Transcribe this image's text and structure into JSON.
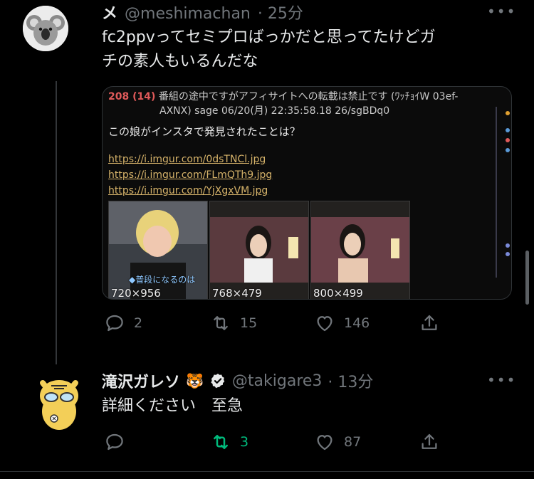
{
  "tweet1": {
    "name": "メ",
    "handle": "@meshimachan",
    "time": "· 25分",
    "more": "•••",
    "text_line1": "fc2ppvってセミプロばっかだと思ってたけどガ",
    "text_line2": "チの素人もいるんだな",
    "media": {
      "post_number": "208 (14)",
      "post_title": "番組の途中ですがアフィサイトへの転載は禁止です",
      "post_author": "(ﾜｯﾁｮｲW 03ef-",
      "post_meta": "AXNX) sage 06/20(月) 22:35:58.18 26/sgBDq0",
      "post_body": "この娘がインスタで発見されたことは？",
      "links": [
        "https://i.imgur.com/0dsTNCl.jpg",
        "https://i.imgur.com/FLmQTh9.jpg",
        "https://i.imgur.com/YjXgxVM.jpg"
      ],
      "thumbnails": [
        "720×956",
        "768×479",
        "800×499"
      ],
      "caption_overlay": "◆普段になるのは"
    },
    "actions": {
      "reply": "2",
      "retweet": "15",
      "like": "146"
    }
  },
  "tweet2": {
    "name": "滝沢ガレソ",
    "name_emoji": "🐯",
    "handle": "@takigare3",
    "time": "· 13分",
    "more": "•••",
    "text": "詳細ください　至急",
    "actions": {
      "reply": "",
      "retweet": "3",
      "like": "87"
    }
  },
  "colors": {
    "background": "#000000",
    "text": "#e7e9ea",
    "muted": "#71767b",
    "retweet_active": "#00ba7c",
    "verified": "#e7e9ea"
  },
  "icons": [
    "reply-icon",
    "retweet-icon",
    "like-icon",
    "share-icon",
    "verified-badge-icon",
    "more-icon"
  ]
}
